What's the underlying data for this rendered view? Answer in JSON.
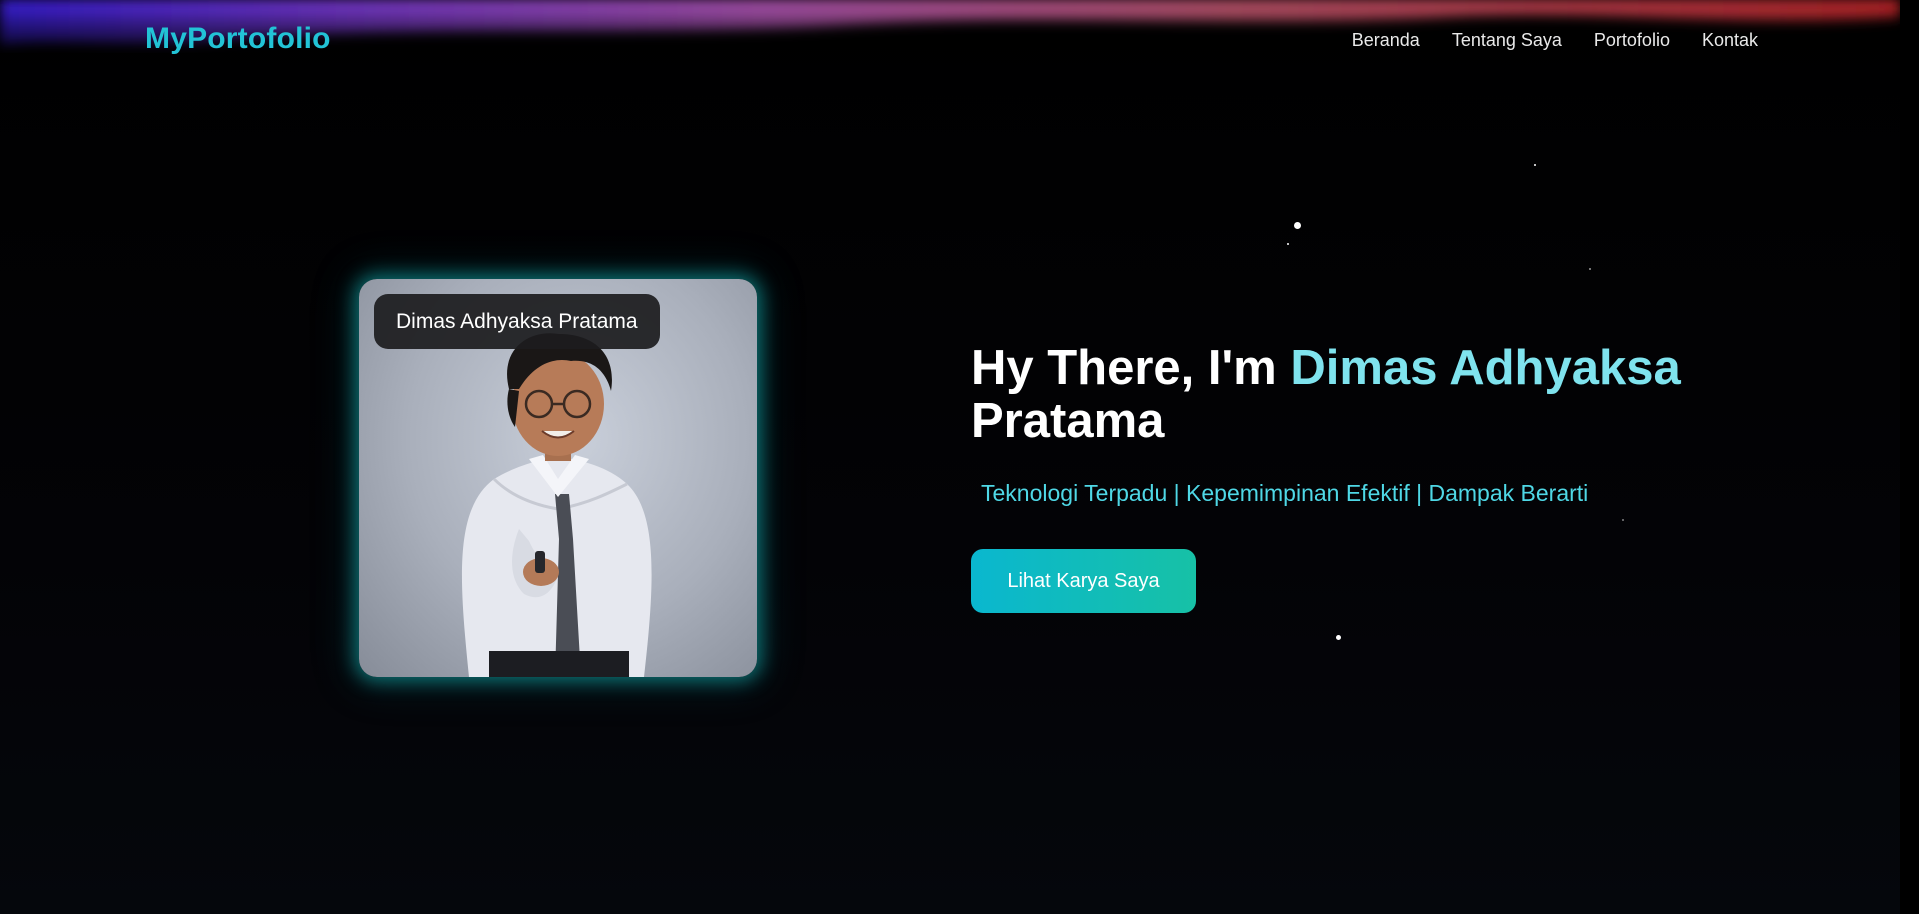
{
  "header": {
    "brand": "MyPortofolio",
    "nav": [
      {
        "label": "Beranda"
      },
      {
        "label": "Tentang Saya"
      },
      {
        "label": "Portofolio"
      },
      {
        "label": "Kontak"
      }
    ]
  },
  "hero": {
    "photo_badge": "Dimas Adhyaksa Pratama",
    "title_prefix": "Hy There, I'm ",
    "title_name_accent": "Dimas Adhyaksa",
    "title_name_rest": "Pratama",
    "tagline": "Teknologi Terpadu | Kepemimpinan Efektif | Dampak Berarti",
    "cta_label": "Lihat Karya Saya"
  },
  "icons": {
    "scroll_up": "triangle-up-icon",
    "scroll_down": "triangle-down-icon"
  },
  "colors": {
    "brand": "#22c3d6",
    "accent_text": "#7fe3ee",
    "tagline": "#4fd8e6",
    "cta_gradient_start": "#0ab7cf",
    "cta_gradient_end": "#17c1a6",
    "card_glow": "#14bebe"
  }
}
